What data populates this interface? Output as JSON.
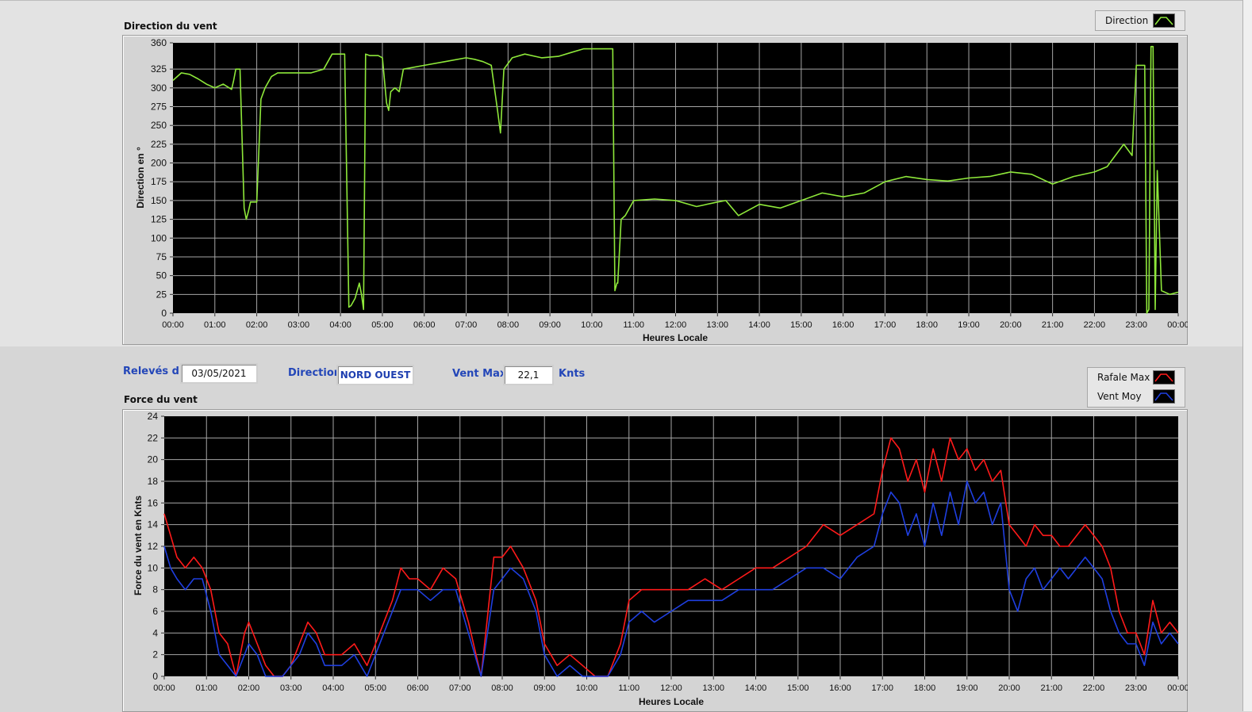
{
  "direction_chart": {
    "title": "Direction du vent",
    "ylabel": "Direction en °",
    "xlabel": "Heures Locale",
    "legend": [
      {
        "label": "Direction",
        "color": "#8ee83a"
      }
    ]
  },
  "info_bar": {
    "releves_label": "Relevés du",
    "releves_value": "03/05/2021",
    "direction_label": "Direction",
    "direction_value": "NORD OUEST",
    "ventmax_label": "Vent Max",
    "ventmax_value": "22,1",
    "unit": "Knts"
  },
  "force_chart": {
    "title": "Force du vent",
    "ylabel": "Force du vent en Knts",
    "xlabel": "Heures Locale",
    "legend": [
      {
        "label": "Rafale Max",
        "color": "#ff1a1a"
      },
      {
        "label": "Vent Moy",
        "color": "#1f3fe0"
      }
    ]
  },
  "colors": {
    "plot_bg": "#000000",
    "grid": "#a6a6a6",
    "direction_line": "#8ee83a",
    "rafale": "#ff1a1a",
    "moyen": "#1f3fe0",
    "label_blue": "#2346b8"
  },
  "chart_data": [
    {
      "type": "line",
      "title": "Direction du vent",
      "xlabel": "Heures Locale",
      "ylabel": "Direction en °",
      "xlim": [
        0,
        24
      ],
      "ylim": [
        0,
        360
      ],
      "x_ticks": [
        "00:00",
        "01:00",
        "02:00",
        "03:00",
        "04:00",
        "05:00",
        "06:00",
        "07:00",
        "08:00",
        "09:00",
        "10:00",
        "11:00",
        "12:00",
        "13:00",
        "14:00",
        "15:00",
        "16:00",
        "17:00",
        "18:00",
        "19:00",
        "20:00",
        "21:00",
        "22:00",
        "23:00",
        "00:00"
      ],
      "y_ticks": [
        0,
        25,
        50,
        75,
        100,
        125,
        150,
        175,
        200,
        225,
        250,
        275,
        300,
        325,
        360
      ],
      "grid": true,
      "series": [
        {
          "name": "Direction",
          "color": "#8ee83a",
          "x": [
            0,
            0.2,
            0.4,
            0.6,
            0.8,
            1,
            1.2,
            1.4,
            1.45,
            1.5,
            1.6,
            1.7,
            1.75,
            1.8,
            1.85,
            1.9,
            2.0,
            2.1,
            2.2,
            2.35,
            2.5,
            2.7,
            3,
            3.3,
            3.6,
            3.8,
            3.95,
            4.1,
            4.2,
            4.25,
            4.35,
            4.45,
            4.5,
            4.55,
            4.6,
            4.7,
            4.8,
            4.9,
            5,
            5.1,
            5.15,
            5.2,
            5.3,
            5.4,
            5.5,
            6,
            6.5,
            7,
            7.2,
            7.4,
            7.6,
            7.75,
            7.82,
            7.9,
            8.1,
            8.4,
            8.8,
            9.2,
            9.5,
            9.8,
            10.2,
            10.5,
            10.55,
            10.6,
            10.62,
            10.7,
            10.8,
            11,
            11.5,
            12,
            12.5,
            13,
            13.2,
            13.5,
            14,
            14.5,
            15,
            15.5,
            16,
            16.5,
            17,
            17.5,
            18,
            18.5,
            19,
            19.5,
            20,
            20.5,
            21,
            21.5,
            22,
            22.3,
            22.5,
            22.7,
            22.9,
            23.0,
            23.15,
            23.2,
            23.25,
            23.3,
            23.35,
            23.4,
            23.45,
            23.5,
            23.6,
            23.8,
            24
          ],
          "y": [
            310,
            320,
            318,
            312,
            305,
            300,
            305,
            298,
            310,
            325,
            325,
            140,
            125,
            135,
            148,
            148,
            148,
            285,
            300,
            315,
            320,
            320,
            320,
            320,
            325,
            345,
            345,
            345,
            8,
            10,
            20,
            40,
            25,
            5,
            345,
            343,
            343,
            343,
            340,
            280,
            270,
            295,
            300,
            295,
            325,
            330,
            335,
            340,
            338,
            335,
            330,
            270,
            240,
            325,
            340,
            345,
            340,
            342,
            347,
            352,
            352,
            352,
            30,
            40,
            40,
            125,
            130,
            150,
            152,
            150,
            142,
            148,
            150,
            130,
            145,
            140,
            150,
            160,
            155,
            160,
            175,
            182,
            178,
            176,
            180,
            182,
            188,
            185,
            172,
            182,
            188,
            195,
            210,
            225,
            210,
            330,
            330,
            330,
            0,
            5,
            355,
            355,
            5,
            190,
            30,
            25,
            28
          ]
        },
        {
          "name": "",
          "color": "#8ee83a",
          "x": [],
          "y": []
        }
      ]
    },
    {
      "type": "line",
      "title": "Force du vent",
      "xlabel": "Heures Locale",
      "ylabel": "Force du vent en Knts",
      "xlim": [
        0,
        24
      ],
      "ylim": [
        0,
        24
      ],
      "x_ticks": [
        "00:00",
        "01:00",
        "02:00",
        "03:00",
        "04:00",
        "05:00",
        "06:00",
        "07:00",
        "08:00",
        "09:00",
        "10:00",
        "11:00",
        "12:00",
        "13:00",
        "14:00",
        "15:00",
        "16:00",
        "17:00",
        "18:00",
        "19:00",
        "20:00",
        "21:00",
        "22:00",
        "23:00",
        "00:00"
      ],
      "y_ticks": [
        0,
        2,
        4,
        6,
        8,
        10,
        12,
        14,
        16,
        18,
        20,
        22,
        24
      ],
      "grid": true,
      "series": [
        {
          "name": "Rafale Max",
          "color": "#ff1a1a",
          "x": [
            0,
            0.15,
            0.3,
            0.5,
            0.7,
            0.9,
            1.1,
            1.3,
            1.5,
            1.7,
            1.9,
            2.0,
            2.2,
            2.4,
            2.6,
            2.8,
            3.0,
            3.2,
            3.4,
            3.6,
            3.8,
            4.0,
            4.2,
            4.5,
            4.8,
            5.0,
            5.2,
            5.4,
            5.6,
            5.8,
            6.0,
            6.3,
            6.6,
            6.9,
            7.2,
            7.5,
            7.8,
            8.0,
            8.2,
            8.5,
            8.8,
            9.0,
            9.3,
            9.6,
            9.9,
            10.2,
            10.5,
            10.8,
            11.0,
            11.3,
            11.6,
            12.0,
            12.4,
            12.8,
            13.2,
            13.6,
            14.0,
            14.4,
            14.8,
            15.2,
            15.6,
            16.0,
            16.4,
            16.8,
            17.0,
            17.2,
            17.4,
            17.6,
            17.8,
            18.0,
            18.2,
            18.4,
            18.6,
            18.8,
            19.0,
            19.2,
            19.4,
            19.6,
            19.8,
            20.0,
            20.2,
            20.4,
            20.6,
            20.8,
            21.0,
            21.2,
            21.4,
            21.6,
            21.8,
            22.0,
            22.2,
            22.4,
            22.6,
            22.8,
            23.0,
            23.2,
            23.4,
            23.6,
            23.8,
            24
          ],
          "y": [
            15,
            13,
            11,
            10,
            11,
            10,
            8,
            4,
            3,
            0,
            4,
            5,
            3,
            1,
            0,
            0,
            1,
            3,
            5,
            4,
            2,
            2,
            2,
            3,
            1,
            3,
            5,
            7,
            10,
            9,
            9,
            8,
            10,
            9,
            5,
            0,
            11,
            11,
            12,
            10,
            7,
            3,
            1,
            2,
            1,
            0,
            0,
            3,
            7,
            8,
            8,
            8,
            8,
            9,
            8,
            9,
            10,
            10,
            11,
            12,
            14,
            13,
            14,
            15,
            19,
            22,
            21,
            18,
            20,
            17,
            21,
            18,
            22,
            20,
            21,
            19,
            20,
            18,
            19,
            14,
            13,
            12,
            14,
            13,
            13,
            12,
            12,
            13,
            14,
            13,
            12,
            10,
            6,
            4,
            4,
            2,
            7,
            4,
            5,
            4
          ]
        },
        {
          "name": "Vent Moy",
          "color": "#1f3fe0",
          "x": [
            0,
            0.15,
            0.3,
            0.5,
            0.7,
            0.9,
            1.1,
            1.3,
            1.5,
            1.7,
            1.9,
            2.0,
            2.2,
            2.4,
            2.6,
            2.8,
            3.0,
            3.2,
            3.4,
            3.6,
            3.8,
            4.0,
            4.2,
            4.5,
            4.8,
            5.0,
            5.2,
            5.4,
            5.6,
            5.8,
            6.0,
            6.3,
            6.6,
            6.9,
            7.2,
            7.5,
            7.8,
            8.0,
            8.2,
            8.5,
            8.8,
            9.0,
            9.3,
            9.6,
            9.9,
            10.2,
            10.5,
            10.8,
            11.0,
            11.3,
            11.6,
            12.0,
            12.4,
            12.8,
            13.2,
            13.6,
            14.0,
            14.4,
            14.8,
            15.2,
            15.6,
            16.0,
            16.4,
            16.8,
            17.0,
            17.2,
            17.4,
            17.6,
            17.8,
            18.0,
            18.2,
            18.4,
            18.6,
            18.8,
            19.0,
            19.2,
            19.4,
            19.6,
            19.8,
            20.0,
            20.2,
            20.4,
            20.6,
            20.8,
            21.0,
            21.2,
            21.4,
            21.6,
            21.8,
            22.0,
            22.2,
            22.4,
            22.6,
            22.8,
            23.0,
            23.2,
            23.4,
            23.6,
            23.8,
            24
          ],
          "y": [
            12,
            10,
            9,
            8,
            9,
            9,
            6,
            2,
            1,
            0,
            2,
            3,
            2,
            0,
            0,
            0,
            1,
            2,
            4,
            3,
            1,
            1,
            1,
            2,
            0,
            2,
            4,
            6,
            8,
            8,
            8,
            7,
            8,
            8,
            4,
            0,
            8,
            9,
            10,
            9,
            6,
            2,
            0,
            1,
            0,
            0,
            0,
            2,
            5,
            6,
            5,
            6,
            7,
            7,
            7,
            8,
            8,
            8,
            9,
            10,
            10,
            9,
            11,
            12,
            15,
            17,
            16,
            13,
            15,
            12,
            16,
            13,
            17,
            14,
            18,
            16,
            17,
            14,
            16,
            8,
            6,
            9,
            10,
            8,
            9,
            10,
            9,
            10,
            11,
            10,
            9,
            6,
            4,
            3,
            3,
            1,
            5,
            3,
            4,
            3
          ]
        }
      ]
    }
  ]
}
